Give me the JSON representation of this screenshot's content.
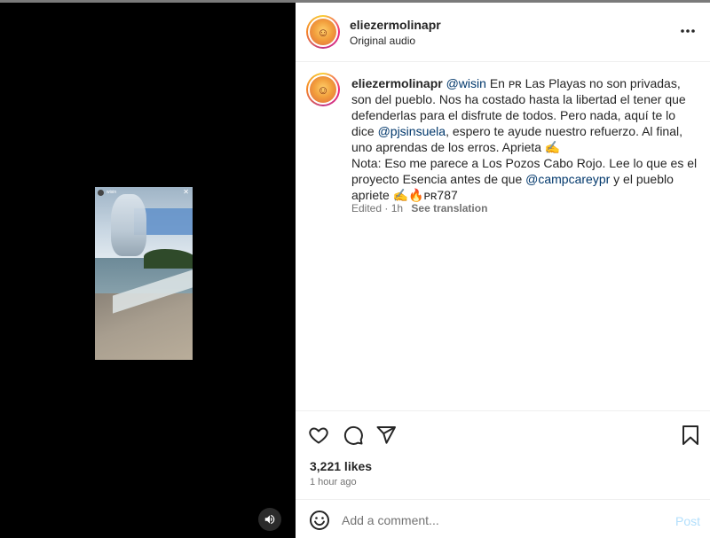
{
  "header": {
    "username": "eliezermolinapr",
    "audio": "Original audio",
    "more_icon": "more-horizontal-icon"
  },
  "video": {
    "overlay_username": "wisin",
    "overlay_close": "✕"
  },
  "caption": {
    "username": "eliezermolinapr",
    "mention_wisin": "@wisin",
    "part1": " En ᴘʀ Las Playas no son privadas, son del pueblo. Nos ha costado hasta la libertad el tener que defenderlas para el disfrute de todos. Pero nada, aquí te lo dice ",
    "mention_pjsinsuela": "@pjsinsuela",
    "part2": ", espero te ayude nuestro refuerzo. Al final, uno aprendas de los erros. Aprieta ✍️",
    "part3": "Nota: Eso me parece a Los Pozos Cabo Rojo. Lee lo que es el proyecto Esencia antes de que ",
    "mention_campcare": "@campcareypr",
    "part4": " y el pueblo apriete ✍️🔥ᴘʀ787",
    "edited": "Edited · 1h",
    "see_translation": "See translation"
  },
  "actions": {
    "like_icon": "heart-icon",
    "comment_icon": "comment-icon",
    "share_icon": "send-icon",
    "save_icon": "bookmark-icon",
    "likes": "3,221 likes",
    "time_ago": "1 hour ago"
  },
  "comment": {
    "placeholder": "Add a comment...",
    "post_label": "Post",
    "emoji_icon": "emoji-icon"
  },
  "colors": {
    "link": "#00376b",
    "post_disabled": "#b2dffc",
    "muted": "#737373"
  }
}
